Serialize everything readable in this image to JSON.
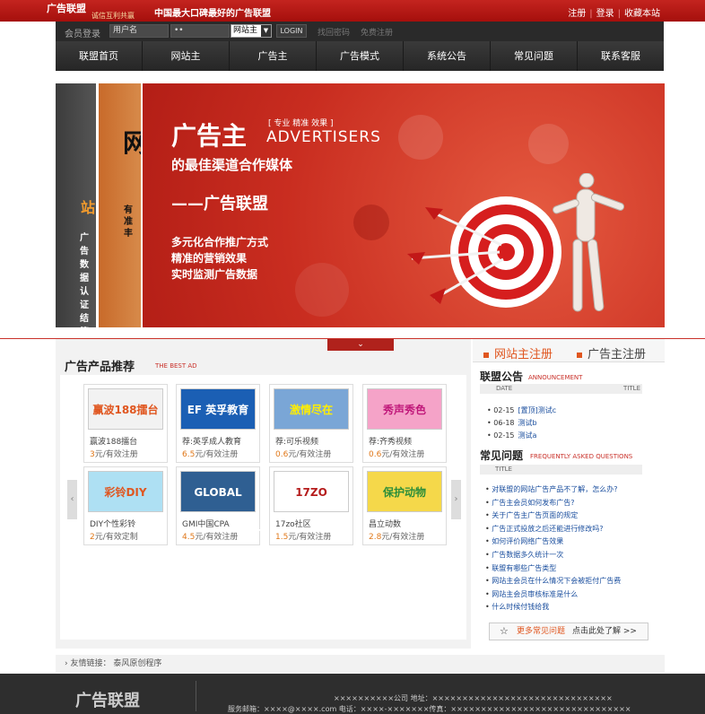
{
  "topbar": {
    "logo_main": "广告联盟",
    "logo_sub": "诚信互利共赢",
    "slogan": "中国最大口碑最好的广告联盟",
    "links": [
      "注册",
      "登录",
      "收藏本站"
    ]
  },
  "login": {
    "label": "会员登录",
    "username_placeholder": "用户名",
    "password_value": "••",
    "role_selected": "网站主",
    "login_btn": "LOGIN",
    "forgot": "找回密码",
    "register": "免费注册"
  },
  "nav": [
    "联盟首页",
    "网站主",
    "广告主",
    "广告模式",
    "系统公告",
    "常见问题",
    "联系客服"
  ],
  "banner": {
    "slide1_title": "站",
    "slide1_lines": [
      "广告",
      "数据",
      "认证",
      "结算"
    ],
    "slide2_title": "网",
    "slide2_lines": [
      "有",
      "准",
      "丰"
    ],
    "main_title": "广告主",
    "main_tag": "[ 专业 精准 效果 ]",
    "main_en": "ADVERTISERS",
    "subtitle": "的最佳渠道合作媒体",
    "brand": "——广告联盟",
    "features": [
      "多元化合作推广方式",
      "精准的营销效果",
      "实时监测广告数据"
    ]
  },
  "products": {
    "title": "广告产品推荐",
    "title_en": "THE BEST AD",
    "items": [
      {
        "img": "赢波188擂台",
        "name": "赢波188擂台",
        "price": "3",
        "unit": "元/有效注册",
        "bg": "#f2f2f2",
        "fg": "#e0561f"
      },
      {
        "img": "EF 英孚教育",
        "name": "荐:英孚成人教育",
        "price": "6.5",
        "unit": "元/有效注册",
        "bg": "#1b5fb4",
        "fg": "#ffffff"
      },
      {
        "img": "激情尽在",
        "name": "荐:可乐视频",
        "price": "0.6",
        "unit": "元/有效注册",
        "bg": "#7aa6d6",
        "fg": "#ffee00"
      },
      {
        "img": "秀声秀色",
        "name": "荐:齐秀视频",
        "price": "0.6",
        "unit": "元/有效注册",
        "bg": "#f5a3c8",
        "fg": "#c0187a"
      },
      {
        "img": "彩铃DIY",
        "name": "DIY个性彩铃",
        "price": "2",
        "unit": "元/有效定制",
        "bg": "#aee0f3",
        "fg": "#e0561f"
      },
      {
        "img": "GLOBAL TESTMARKET",
        "name": "GMI中国CPA",
        "price": "4.5",
        "unit": "元/有效注册",
        "bg": "#2f5f92",
        "fg": "#ffffff"
      },
      {
        "img": "17ZO",
        "name": "17zo社区",
        "price": "1.5",
        "unit": "元/有效注册",
        "bg": "#ffffff",
        "fg": "#b51c1c"
      },
      {
        "img": "保护动物",
        "name": "昌立动数",
        "price": "2.8",
        "unit": "元/有效注册",
        "bg": "#f5d84a",
        "fg": "#2c8e3a"
      }
    ]
  },
  "sidebar": {
    "tab1": "网站主注册",
    "tab2": "广告主注册",
    "notice_title": "联盟公告",
    "notice_en": "ANNOUNCEMENT",
    "col_date": "DATE",
    "col_title": "TITLE",
    "notices": [
      {
        "date": "02-15",
        "title": "[置顶]测试c"
      },
      {
        "date": "06-18",
        "title": "测试b"
      },
      {
        "date": "02-15",
        "title": "测试a"
      }
    ],
    "faq_title": "常见问题",
    "faq_en": "FREQUENTLY ASKED QUESTIONS",
    "faq_col": "TITLE",
    "faqs": [
      "对联盟的网站广告产品不了解，怎么办?",
      "广告主会员如何发布广告?",
      "关于广告主广告页面的规定",
      "广告正式投放之后还能进行修改吗?",
      "如何评价网络广告效果",
      "广告数据多久统计一次",
      "联盟有哪些广告类型",
      "网站主会员在什么情况下会被拒付广告费",
      "网站主会员审核标准是什么",
      "什么时候付钱给我"
    ],
    "more_a": "更多常见问题",
    "more_b": "点击此处了解 >>"
  },
  "friend": {
    "label": "友情链接：",
    "link": "泰风原创程序"
  },
  "footer": {
    "logo": "广告联盟",
    "line1": "××××××××××公司 地址：××××××××××××××××××××××××××××××",
    "line2": "服务邮箱：××××@××××.com 电话：××××-×××××××传真：××××××××××××××××××××××××××××××"
  },
  "colors": {
    "brand_red": "#c4241f",
    "nav_dark": "#2a2a2a",
    "link_blue": "#1a4e9e",
    "accent_orange": "#e0781a"
  }
}
